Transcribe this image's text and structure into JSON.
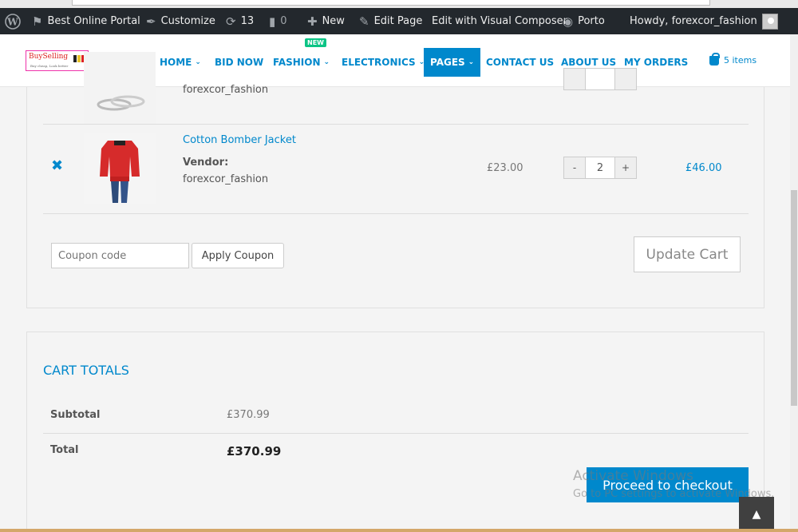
{
  "adminbar": {
    "site_name": "Best Online Portal",
    "customize": "Customize",
    "updates_count": "13",
    "comments_count": "0",
    "new_label": "New",
    "edit_page": "Edit Page",
    "visual_composer": "Edit with Visual Composer",
    "theme": "Porto",
    "greeting": "Howdy, forexcor_fashion"
  },
  "header": {
    "logo_text": "BuySelling",
    "logo_tag": "Buy cheap, Look better",
    "nav": {
      "home": "HOME",
      "bid_now": "BID NOW",
      "fashion": "FASHION",
      "fashion_badge": "NEW",
      "electronics": "ELECTRONICS",
      "pages": "PAGES",
      "contact": "CONTACT US",
      "about": "ABOUT US",
      "orders": "MY ORDERS"
    },
    "cart_label": "5 items"
  },
  "cart": {
    "rows": [
      {
        "vendor_name": "forexcor_fashion"
      },
      {
        "name": "Cotton Bomber Jacket",
        "vendor_label": "Vendor:",
        "vendor_name": "forexcor_fashion",
        "price": "£23.00",
        "qty": "2",
        "subtotal": "£46.00",
        "minus": "-",
        "plus": "+"
      }
    ],
    "coupon_placeholder": "Coupon code",
    "apply_label": "Apply Coupon",
    "update_label": "Update Cart"
  },
  "totals": {
    "title": "CART TOTALS",
    "subtotal_label": "Subtotal",
    "subtotal_value": "£370.99",
    "total_label": "Total",
    "total_value": "£370.99",
    "checkout_label": "Proceed to checkout"
  },
  "watermark": {
    "line1": "Activate Windows",
    "line2": "Go to PC settings to activate Windows."
  },
  "colors": {
    "accent": "#0088cc",
    "adminbar": "#23282d",
    "badge": "#0cc485"
  }
}
